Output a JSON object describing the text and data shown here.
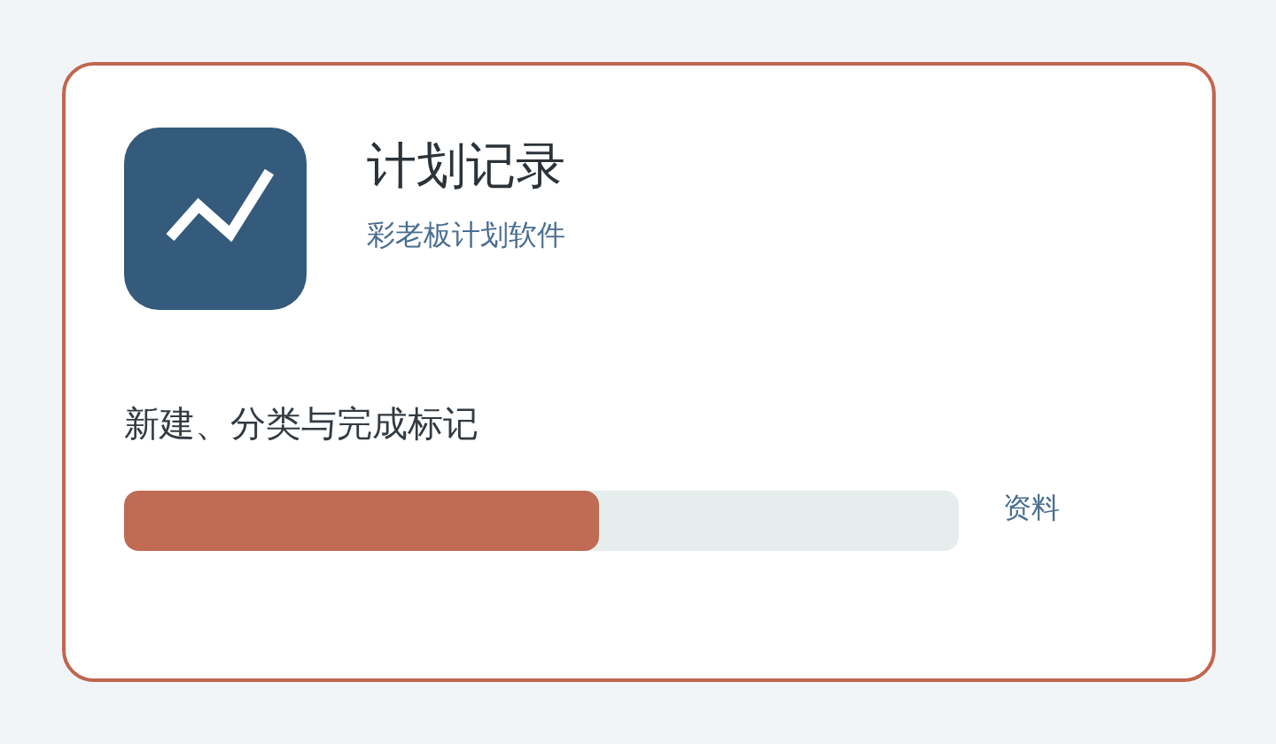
{
  "app": {
    "title": "计划记录",
    "subtitle": "彩老板计划软件"
  },
  "description": "新建、分类与完成标记",
  "progress": {
    "level": 0.57
  },
  "link": "资料"
}
